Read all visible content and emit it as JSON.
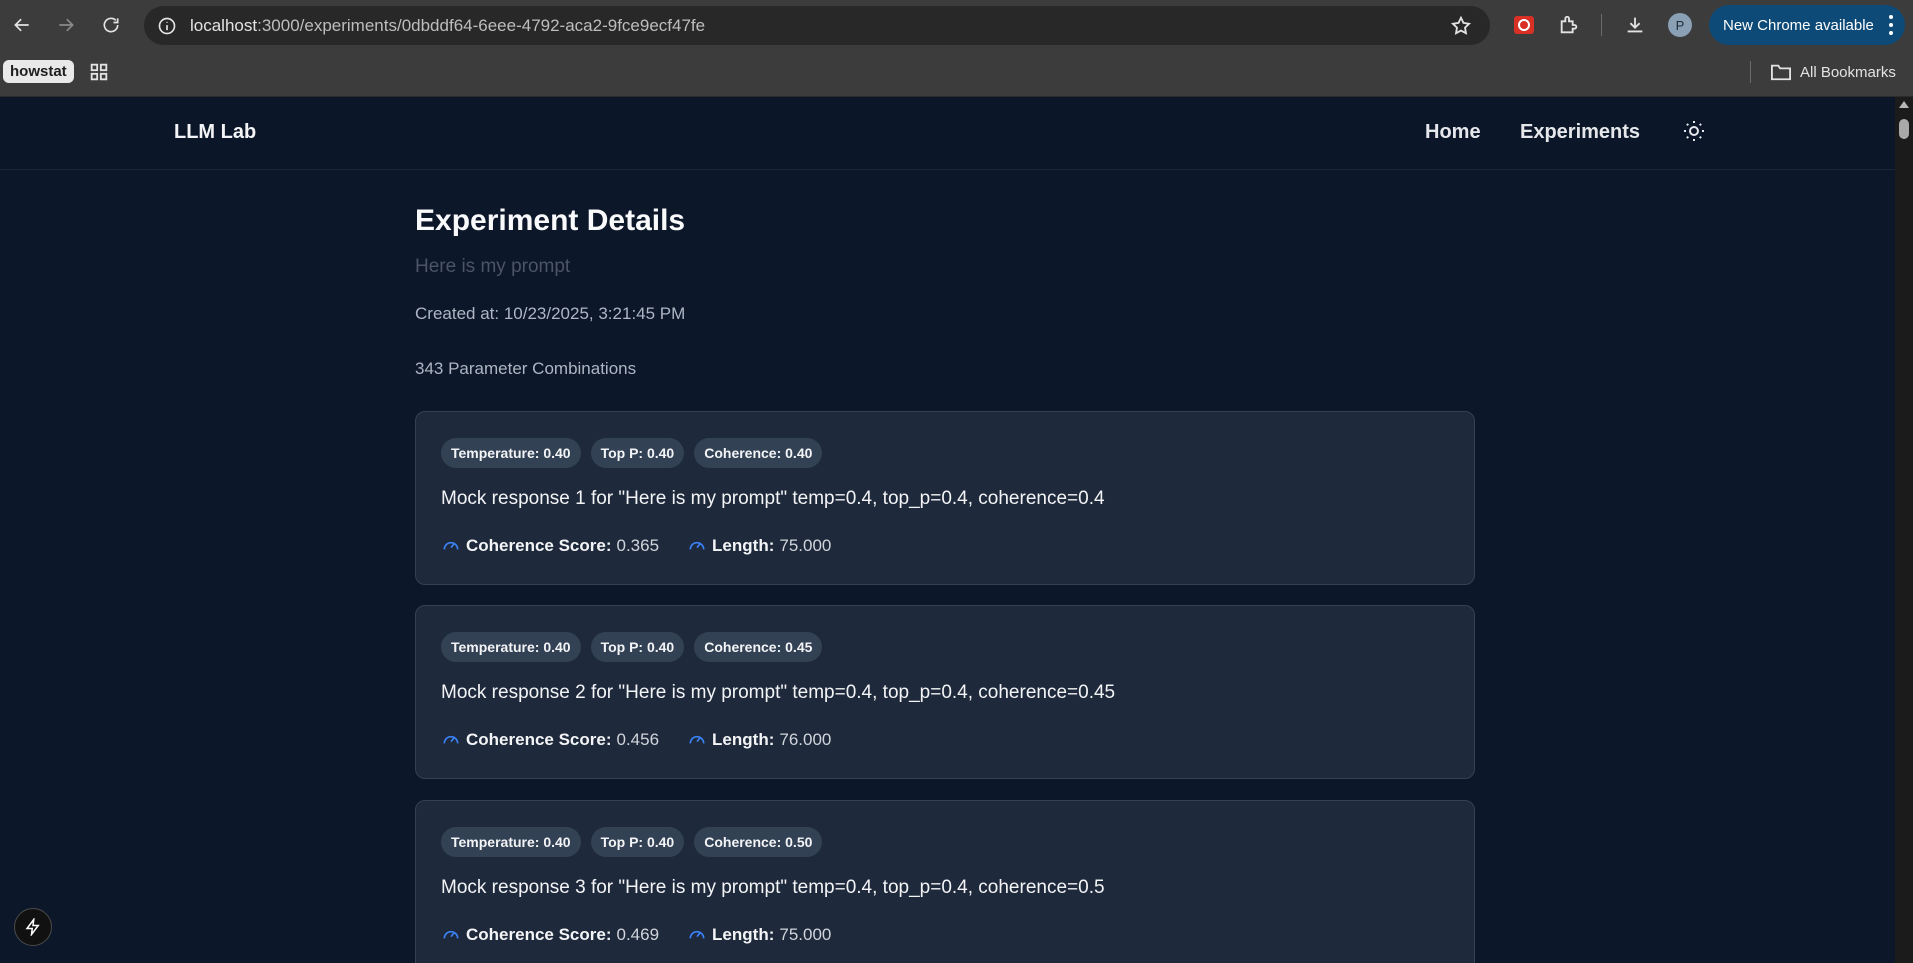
{
  "browser": {
    "url_host": "localhost",
    "url_rest": ":3000/experiments/0dbddf64-6eee-4792-aca2-9fce9ecf47fe",
    "update_label": "New Chrome available",
    "avatar_letter": "P",
    "bookmark_chip": "howstat",
    "all_bookmarks": "All Bookmarks"
  },
  "app": {
    "brand": "LLM Lab",
    "nav": {
      "home": "Home",
      "experiments": "Experiments"
    }
  },
  "experiment": {
    "title": "Experiment Details",
    "prompt": "Here is my prompt",
    "created_at": "Created at: 10/23/2025, 3:21:45 PM",
    "combinations": "343 Parameter Combinations"
  },
  "results": [
    {
      "badges": [
        "Temperature: 0.40",
        "Top P: 0.40",
        "Coherence: 0.40"
      ],
      "response": "Mock response 1 for \"Here is my prompt\" temp=0.4, top_p=0.4, coherence=0.4",
      "coherence_label": "Coherence Score:",
      "coherence_value": "0.365",
      "length_label": "Length:",
      "length_value": "75.000"
    },
    {
      "badges": [
        "Temperature: 0.40",
        "Top P: 0.40",
        "Coherence: 0.45"
      ],
      "response": "Mock response 2 for \"Here is my prompt\" temp=0.4, top_p=0.4, coherence=0.45",
      "coherence_label": "Coherence Score:",
      "coherence_value": "0.456",
      "length_label": "Length:",
      "length_value": "76.000"
    },
    {
      "badges": [
        "Temperature: 0.40",
        "Top P: 0.40",
        "Coherence: 0.50"
      ],
      "response": "Mock response 3 for \"Here is my prompt\" temp=0.4, top_p=0.4, coherence=0.5",
      "coherence_label": "Coherence Score:",
      "coherence_value": "0.469",
      "length_label": "Length:",
      "length_value": "75.000"
    }
  ],
  "colors": {
    "page_bg": "#0d172a",
    "card_bg": "#1e293b",
    "accent": "#3b82f6",
    "update_btn": "#0d4a77"
  }
}
